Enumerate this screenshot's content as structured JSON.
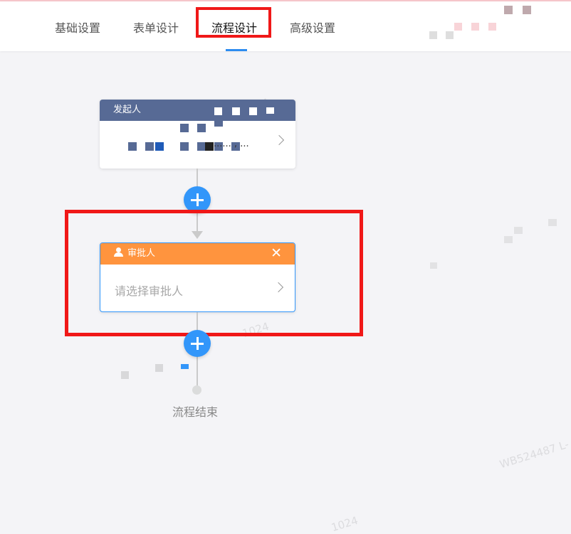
{
  "tabs": [
    {
      "label": "基础设置"
    },
    {
      "label": "表单设计"
    },
    {
      "label": "流程设计"
    },
    {
      "label": "高级设置"
    }
  ],
  "start_node": {
    "title": "发起人",
    "content": "...... , ..."
  },
  "approver_node": {
    "title": "审批人",
    "close": "✕",
    "placeholder": "请选择审批人"
  },
  "end_label": "流程结束",
  "watermarks": [
    "WB524487 L-",
    "1024",
    "1024",
    "1024"
  ],
  "colors": {
    "accent": "#3296fa",
    "start_header": "#576a95",
    "approver_header": "#ff943e",
    "highlight": "#f01818"
  }
}
